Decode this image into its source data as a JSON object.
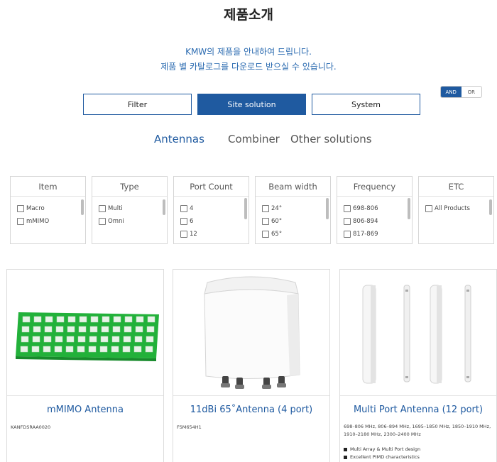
{
  "page": {
    "title": "제품소개"
  },
  "intro": {
    "line1": "KMW의 제품을 안내하여 드립니다.",
    "line2": "제품 별 카탈로그를 다운로드 받으실 수 있습니다."
  },
  "tabs": {
    "filter": "Filter",
    "site_solution": "Site solution",
    "system": "System"
  },
  "toggle": {
    "and": "AND",
    "or": "OR"
  },
  "subtabs": {
    "antennas": "Antennas",
    "combiner": "Combiner",
    "other": "Other solutions"
  },
  "filters": [
    {
      "title": "Item",
      "options": [
        "Macro",
        "mMIMO"
      ]
    },
    {
      "title": "Type",
      "options": [
        "Multi",
        "Omni"
      ]
    },
    {
      "title": "Port Count",
      "options": [
        "4",
        "6",
        "12"
      ]
    },
    {
      "title": "Beam width",
      "options": [
        "24°",
        "60°",
        "65°"
      ]
    },
    {
      "title": "Frequency",
      "options": [
        "698-806",
        "806-894",
        "817-869"
      ]
    },
    {
      "title": "ETC",
      "options": [
        "All Products"
      ]
    }
  ],
  "products": [
    {
      "name": "mMIMO Antenna",
      "code": "KANFDSRAA0020"
    },
    {
      "name": "11dBi 65˚Antenna (4 port)",
      "code": "FSM654H1"
    },
    {
      "name": "Multi Port Antenna (12 port)",
      "spec": "698–806 MHz, 806–894 MHz, 1695–1850 MHz, 1850–1910 MHz, 1910–2180 MHz, 2300–2400 MHz",
      "features": [
        "Multi Array & Multi Port design",
        "Excellent PIMD characteristics"
      ]
    }
  ],
  "colors": {
    "accent": "#1f5aa0",
    "pcb_green": "#22b13a"
  }
}
